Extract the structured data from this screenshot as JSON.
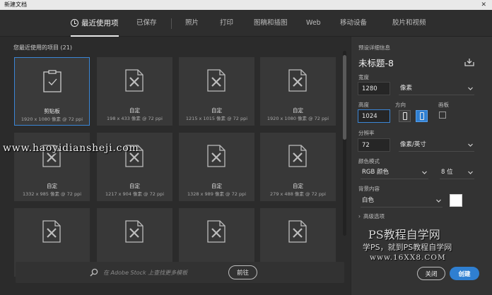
{
  "window": {
    "title": "新建文档",
    "close_icon": "close-icon"
  },
  "tabs": [
    {
      "label": "最近使用项",
      "active": true
    },
    {
      "label": "已保存"
    },
    {
      "label": "照片"
    },
    {
      "label": "打印"
    },
    {
      "label": "图稿和插图"
    },
    {
      "label": "Web"
    },
    {
      "label": "移动设备"
    },
    {
      "label": "胶片和视频"
    }
  ],
  "recent": {
    "heading": "您最近使用的项目 (21)",
    "items": [
      {
        "name": "剪贴板",
        "size": "1920 x 1080 像素 @ 72 ppi",
        "icon": "clipboard-doc-icon",
        "selected": true
      },
      {
        "name": "自定",
        "size": "198 x 433 像素 @ 72 ppi",
        "icon": "custom-doc-icon"
      },
      {
        "name": "自定",
        "size": "1215 x 1015 像素 @ 72 ppi",
        "icon": "custom-doc-icon"
      },
      {
        "name": "自定",
        "size": "1920 x 1080 像素 @ 72 ppi",
        "icon": "custom-doc-icon"
      },
      {
        "name": "自定",
        "size": "1332 x 985 像素 @ 72 ppi",
        "icon": "custom-doc-icon"
      },
      {
        "name": "自定",
        "size": "1217 x 904 像素 @ 72 ppi",
        "icon": "custom-doc-icon"
      },
      {
        "name": "自定",
        "size": "1328 x 989 像素 @ 72 ppi",
        "icon": "custom-doc-icon"
      },
      {
        "name": "自定",
        "size": "279 x 488 像素 @ 72 ppi",
        "icon": "custom-doc-icon"
      },
      {
        "name": "",
        "size": "",
        "icon": "custom-doc-icon"
      },
      {
        "name": "",
        "size": "",
        "icon": "custom-doc-icon"
      },
      {
        "name": "",
        "size": "",
        "icon": "custom-doc-icon"
      },
      {
        "name": "",
        "size": "",
        "icon": "custom-doc-icon"
      }
    ]
  },
  "stock": {
    "placeholder": "在 Adobe Stock 上查找更多模板",
    "go_label": "前往"
  },
  "watermark": "www.haoyidiansheji.com",
  "details": {
    "section_title": "预设详细信息",
    "preset_name": "未标题-8",
    "width_label": "宽度",
    "width_value": "1280",
    "width_unit": "像素",
    "height_label": "高度",
    "height_value": "1024",
    "orientation_label": "方向",
    "artboard_label": "画板",
    "resolution_label": "分辨率",
    "resolution_value": "72",
    "resolution_unit": "像素/英寸",
    "color_mode_label": "颜色模式",
    "color_mode_value": "RGB 颜色",
    "bit_depth": "8 位",
    "background_label": "背景内容",
    "background_value": "白色",
    "background_color": "#ffffff",
    "advanced_label": "高级选项",
    "close_label": "关闭",
    "create_label": "创建"
  },
  "overlay": {
    "line1": "PS教程自学网",
    "line2": "学PS，就到PS教程自学网",
    "line3": "www.16XX8.COM"
  },
  "colors": {
    "accent": "#2f7fd1",
    "selection": "#3b86d6"
  }
}
